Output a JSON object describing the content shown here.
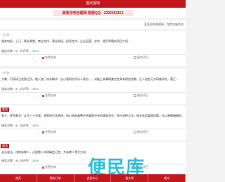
{
  "header": {
    "title": "首页首吧"
  },
  "banner": {
    "text": "某某孙吧合理网 客服QQ：2292462151"
  },
  "notice": {
    "text": "某某孙吧合理网，保定市服务项"
  },
  "posts": [
    {
      "tag": "1分钟",
      "tag_style": "gray",
      "desc": "服务包括：上门，择长频频，商业合作，事业财运，投资合作，企业运营，求学，提升等服务项目介绍...",
      "stat_label_1": "服务次数：",
      "count": "57",
      "stat_label_2": "好评率：",
      "rate": "100%",
      "action_1": "免费咨询",
      "action_2": "服务项目"
    },
    {
      "tag": "1分钟",
      "tag_style": "gray",
      "desc": "大教，可深研主发意之所，融入各门派系精华，自小喜研究风水人观点，，对破土来事情美究性具有建造优解，注人加型元为四维研究，管汇...",
      "stat_label_1": "服务次数：",
      "count": "57",
      "stat_label_2": "好评率：",
      "rate": "100%",
      "action_1": "免费咨询",
      "action_2": "服务项目"
    },
    {
      "tag": "置顶",
      "tag_style": "red",
      "desc": "老王，姓师黄龙！从东三十余载，潜孝研究其易经，热心结纳真整并结事和中有的情耳觉究，熟马多种方法，擅长各类疑难问题，无以感情婚姻财...",
      "stat_label_1": "服务次数：",
      "count": "81",
      "stat_label_2": "好评率：",
      "rate": "100%",
      "action_1": "免费咨询",
      "action_2": "服务项目"
    },
    {
      "tag": "置顶",
      "tag_style": "red",
      "desc": "长法观法，找按有缘人，达观数十年明确会已定，为有缘人等引方向",
      "stat_label_1": "服务次数：",
      "count": "90",
      "stat_label_2": "好评率：",
      "rate": "100%",
      "action_1": "免费咨询",
      "action_2": "服务项目"
    }
  ],
  "watermark": "便民库",
  "nav": [
    {
      "label": "首页"
    },
    {
      "label": "我的订单"
    },
    {
      "label": "会员中心"
    },
    {
      "label": "找大师"
    },
    {
      "label": "吧内"
    }
  ]
}
